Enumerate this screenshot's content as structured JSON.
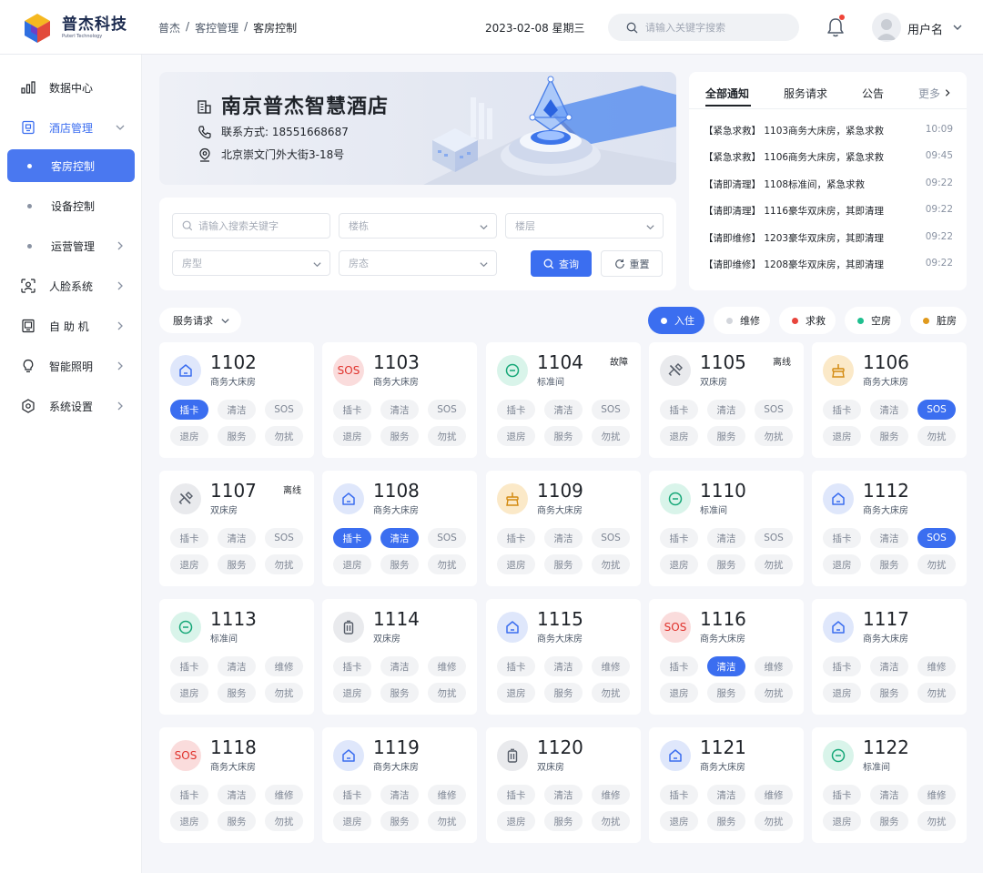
{
  "brand": {
    "name": "普杰科技",
    "en": "Puterl Technology"
  },
  "breadcrumb": [
    "普杰",
    "客控管理",
    "客房控制"
  ],
  "breadcrumb_sep": "/",
  "date": "2023-02-08 星期三",
  "search": {
    "placeholder": "请输入关键字搜索"
  },
  "user": {
    "name": "用户名"
  },
  "sidebar": [
    {
      "label": "数据中心",
      "icon": "bar-chart-icon"
    },
    {
      "label": "酒店管理",
      "icon": "hotel-icon",
      "expanded": true
    },
    {
      "label": "客房控制",
      "sub": true,
      "active": true
    },
    {
      "label": "设备控制",
      "sub": true
    },
    {
      "label": "运营管理",
      "sub": true,
      "chevron": true
    },
    {
      "label": "人脸系统",
      "icon": "face-scan-icon",
      "chevron": true
    },
    {
      "label": "自 助 机",
      "icon": "kiosk-icon",
      "chevron": true
    },
    {
      "label": "智能照明",
      "icon": "bulb-icon",
      "chevron": true
    },
    {
      "label": "系统设置",
      "icon": "settings-icon",
      "chevron": true
    }
  ],
  "hotel": {
    "name": "南京普杰智慧酒店",
    "contact": "联系方式: 18551668687",
    "address": "北京崇文门外大街3-18号"
  },
  "notice": {
    "tabs": [
      "全部通知",
      "服务请求",
      "公告"
    ],
    "more": "更多",
    "items": [
      {
        "text": "【紧急求救】 1103商务大床房，紧急求救",
        "time": "10:09"
      },
      {
        "text": "【紧急求救】 1106商务大床房，紧急求救",
        "time": "09:45"
      },
      {
        "text": "【请即清理】 1108标准间，紧急求救",
        "time": "09:22"
      },
      {
        "text": "【请即清理】 1116豪华双床房，其即清理",
        "time": "09:22"
      },
      {
        "text": "【请即维修】 1203豪华双床房，其即清理",
        "time": "09:22"
      },
      {
        "text": "【请即维修】 1208豪华双床房，其即清理",
        "time": "09:22"
      }
    ]
  },
  "filters": {
    "keyword": "请输入搜索关键字",
    "building": "楼栋",
    "floor": "楼层",
    "room_type": "房型",
    "room_state": "房态",
    "query": "查询",
    "reset": "重置"
  },
  "service_select": "服务请求",
  "legend": [
    {
      "label": "入住",
      "color": "#ffffff",
      "active": true
    },
    {
      "label": "维修",
      "color": "#d3d6dc"
    },
    {
      "label": "求救",
      "color": "#e8453c"
    },
    {
      "label": "空房",
      "color": "#1fbf8f"
    },
    {
      "label": "脏房",
      "color": "#e09a1d"
    }
  ],
  "rooms": [
    {
      "num": "1102",
      "type": "商务大床房",
      "status": "",
      "icon": "house-icon",
      "kind": "blue",
      "buttons": [
        "插卡",
        "清洁",
        "SOS",
        "退房",
        "服务",
        "勿扰"
      ],
      "on": [
        0
      ]
    },
    {
      "num": "1103",
      "type": "商务大床房",
      "status": "",
      "icon": "sos-icon",
      "kind": "red",
      "sos": "SOS",
      "buttons": [
        "插卡",
        "清洁",
        "SOS",
        "退房",
        "服务",
        "勿扰"
      ],
      "on": []
    },
    {
      "num": "1104",
      "type": "标准间",
      "status": "故障",
      "icon": "minus-circle-icon",
      "kind": "green",
      "buttons": [
        "插卡",
        "清洁",
        "SOS",
        "退房",
        "服务",
        "勿扰"
      ],
      "on": []
    },
    {
      "num": "1105",
      "type": "双床房",
      "status": "离线",
      "icon": "tools-icon",
      "kind": "gray",
      "buttons": [
        "插卡",
        "清洁",
        "SOS",
        "退房",
        "服务",
        "勿扰"
      ],
      "on": []
    },
    {
      "num": "1106",
      "type": "商务大床房",
      "status": "",
      "icon": "broom-icon",
      "kind": "orange",
      "buttons": [
        "插卡",
        "清洁",
        "SOS",
        "退房",
        "服务",
        "勿扰"
      ],
      "on": [
        2
      ]
    },
    {
      "num": "1107",
      "type": "双床房",
      "status": "离线",
      "icon": "tools-icon",
      "kind": "gray",
      "buttons": [
        "插卡",
        "清洁",
        "SOS",
        "退房",
        "服务",
        "勿扰"
      ],
      "on": []
    },
    {
      "num": "1108",
      "type": "商务大床房",
      "status": "",
      "icon": "house-icon",
      "kind": "blue",
      "buttons": [
        "插卡",
        "清洁",
        "SOS",
        "退房",
        "服务",
        "勿扰"
      ],
      "on": [
        0,
        1
      ]
    },
    {
      "num": "1109",
      "type": "商务大床房",
      "status": "",
      "icon": "broom-icon",
      "kind": "orange",
      "buttons": [
        "插卡",
        "清洁",
        "SOS",
        "退房",
        "服务",
        "勿扰"
      ],
      "on": []
    },
    {
      "num": "1110",
      "type": "标准间",
      "status": "",
      "icon": "minus-circle-icon",
      "kind": "green",
      "buttons": [
        "插卡",
        "清洁",
        "SOS",
        "退房",
        "服务",
        "勿扰"
      ],
      "on": []
    },
    {
      "num": "1112",
      "type": "商务大床房",
      "status": "",
      "icon": "house-icon",
      "kind": "blue",
      "buttons": [
        "插卡",
        "清洁",
        "SOS",
        "退房",
        "服务",
        "勿扰"
      ],
      "on": [
        2
      ]
    },
    {
      "num": "1113",
      "type": "标准间",
      "status": "",
      "icon": "minus-circle-icon",
      "kind": "green",
      "buttons": [
        "插卡",
        "清洁",
        "维修",
        "退房",
        "服务",
        "勿扰"
      ],
      "on": []
    },
    {
      "num": "1114",
      "type": "双床房",
      "status": "",
      "icon": "trash-icon",
      "kind": "gray",
      "buttons": [
        "插卡",
        "清洁",
        "维修",
        "退房",
        "服务",
        "勿扰"
      ],
      "on": []
    },
    {
      "num": "1115",
      "type": "商务大床房",
      "status": "",
      "icon": "house-icon",
      "kind": "blue",
      "buttons": [
        "插卡",
        "清洁",
        "维修",
        "退房",
        "服务",
        "勿扰"
      ],
      "on": []
    },
    {
      "num": "1116",
      "type": "商务大床房",
      "status": "",
      "icon": "sos-icon",
      "kind": "red",
      "sos": "SOS",
      "buttons": [
        "插卡",
        "清洁",
        "维修",
        "退房",
        "服务",
        "勿扰"
      ],
      "on": [
        1
      ]
    },
    {
      "num": "1117",
      "type": "商务大床房",
      "status": "",
      "icon": "house-icon",
      "kind": "blue",
      "buttons": [
        "插卡",
        "清洁",
        "维修",
        "退房",
        "服务",
        "勿扰"
      ],
      "on": []
    },
    {
      "num": "1118",
      "type": "商务大床房",
      "status": "",
      "icon": "sos-icon",
      "kind": "red",
      "sos": "SOS",
      "buttons": [
        "插卡",
        "清洁",
        "维修",
        "退房",
        "服务",
        "勿扰"
      ],
      "on": []
    },
    {
      "num": "1119",
      "type": "商务大床房",
      "status": "",
      "icon": "house-icon",
      "kind": "blue",
      "buttons": [
        "插卡",
        "清洁",
        "维修",
        "退房",
        "服务",
        "勿扰"
      ],
      "on": []
    },
    {
      "num": "1120",
      "type": "双床房",
      "status": "",
      "icon": "trash-icon",
      "kind": "gray",
      "buttons": [
        "插卡",
        "清洁",
        "维修",
        "退房",
        "服务",
        "勿扰"
      ],
      "on": []
    },
    {
      "num": "1121",
      "type": "商务大床房",
      "status": "",
      "icon": "house-icon",
      "kind": "blue",
      "buttons": [
        "插卡",
        "清洁",
        "维修",
        "退房",
        "服务",
        "勿扰"
      ],
      "on": []
    },
    {
      "num": "1122",
      "type": "标准间",
      "status": "",
      "icon": "minus-circle-icon",
      "kind": "green",
      "buttons": [
        "插卡",
        "清洁",
        "维修",
        "退房",
        "服务",
        "勿扰"
      ],
      "on": []
    }
  ],
  "colors": {
    "accent": "#3b6ef0",
    "blue_bg": "#dfe7fb",
    "red_bg": "#fadcdc",
    "green_bg": "#d9f4ea",
    "orange_bg": "#fbe9c8",
    "gray_bg": "#e9eaed"
  }
}
